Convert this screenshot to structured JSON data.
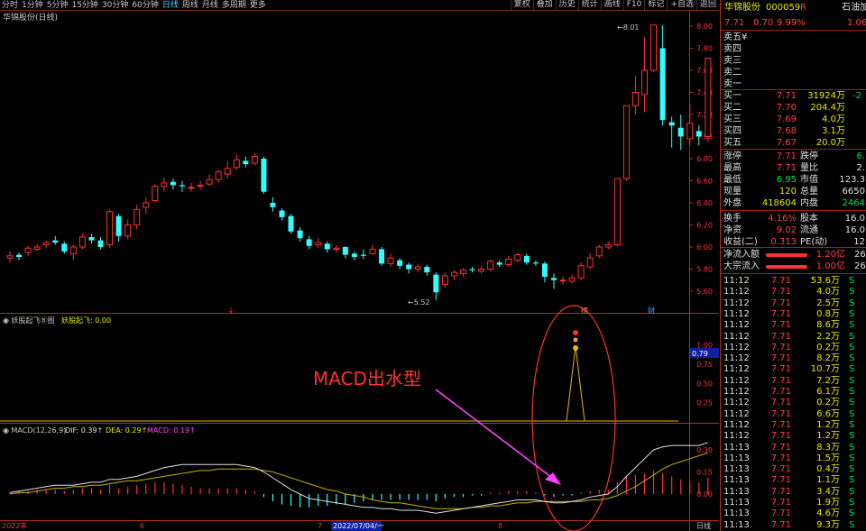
{
  "toolbar": {
    "tabs": [
      "分时",
      "1分钟",
      "5分钟",
      "15分钟",
      "30分钟",
      "60分钟",
      "日线",
      "周线",
      "月线",
      "多周期",
      "更多"
    ],
    "active": "日线",
    "buttons": [
      "复权",
      "叠加",
      "历史",
      "统计",
      "画线",
      "F10",
      "标记",
      "+自选",
      "返回"
    ]
  },
  "main_chart": {
    "title": "华锦股份(日线)",
    "price_axis": [
      "8.00",
      "7.80",
      "7.60",
      "7.40",
      "7.20",
      "7.00",
      "6.80",
      "6.60",
      "6.40",
      "6.20",
      "6.00",
      "5.80",
      "5.60"
    ],
    "high_label": "8.01",
    "low_label": "5.52",
    "marks": {
      "m1": "↓",
      "m2": "榜",
      "m3": "财"
    }
  },
  "indicator1": {
    "title": "妖股起飞Ⓑ图",
    "value_label": "妖股起飞: 0.00",
    "axis": [
      "1.00",
      "0.75",
      "0.50",
      "0.25"
    ],
    "current": "0.79"
  },
  "annotation": "MACD出水型",
  "macd": {
    "title": "MACD(12,26,9)",
    "dif": "DIF: 0.39↑",
    "dea": "DEA: 0.29↑",
    "macd": "MACD: 0.19↑",
    "axis": [
      "0.30",
      "0.15",
      "0.00"
    ]
  },
  "date_axis": {
    "labels": [
      "2022年",
      "6",
      "7",
      "2022/07/04/一",
      "8"
    ],
    "period": "日线"
  },
  "quote": {
    "name": "华锦股份",
    "code": "000059",
    "flag": "R",
    "tab": "石油加工",
    "price": "7.71",
    "change": "0.70",
    "pct": "9.99%",
    "side_val": "1.06",
    "asks": [
      {
        "label": "卖五",
        "price": "",
        "vol": ""
      },
      {
        "label": "卖四",
        "price": "",
        "vol": ""
      },
      {
        "label": "卖三",
        "price": "",
        "vol": ""
      },
      {
        "label": "卖二",
        "price": "",
        "vol": ""
      },
      {
        "label": "卖一",
        "price": "",
        "vol": ""
      }
    ],
    "ask_sign": "¥",
    "bids": [
      {
        "label": "买一",
        "price": "7.71",
        "vol": "31924万",
        "extra": "-2"
      },
      {
        "label": "买二",
        "price": "7.70",
        "vol": "204.4万",
        "extra": ""
      },
      {
        "label": "买三",
        "price": "7.69",
        "vol": "4.0万",
        "extra": ""
      },
      {
        "label": "买四",
        "price": "7.68",
        "vol": "3.1万",
        "extra": ""
      },
      {
        "label": "买五",
        "price": "7.67",
        "vol": "20.0万",
        "extra": ""
      }
    ],
    "stats": [
      {
        "l1": "涨停",
        "v1": "7.71",
        "l2": "跌停",
        "v2": "6."
      },
      {
        "l1": "最高",
        "v1": "7.71",
        "l2": "量比",
        "v2": "2."
      },
      {
        "l1": "最低",
        "v1": "6.95",
        "l2": "市值",
        "v2": "123.3"
      },
      {
        "l1": "现量",
        "v1": "120",
        "l2": "总量",
        "v2": "6650"
      },
      {
        "l1": "外盘",
        "v1": "418604",
        "l2": "内盘",
        "v2": "2464"
      },
      {
        "l1": "换手",
        "v1": "4.16%",
        "l2": "股本",
        "v2": "16.0"
      },
      {
        "l1": "净资",
        "v1": "9.02",
        "l2": "流通",
        "v2": "16.0"
      },
      {
        "l1": "收益(二)",
        "v1": "0.313",
        "l2": "PE(动)",
        "v2": "12"
      }
    ],
    "flows": [
      {
        "label": "净流入额",
        "value": "1.20亿",
        "extra": "26"
      },
      {
        "label": "大宗流入",
        "value": "1.00亿",
        "extra": "26"
      }
    ],
    "ticks": [
      {
        "t": "11:12",
        "p": "7.71",
        "v": "53.6万",
        "s": "S"
      },
      {
        "t": "11:12",
        "p": "7.71",
        "v": "4.0万",
        "s": "S"
      },
      {
        "t": "11:12",
        "p": "7.71",
        "v": "2.5万",
        "s": "S"
      },
      {
        "t": "11:12",
        "p": "7.71",
        "v": "0.8万",
        "s": "S"
      },
      {
        "t": "11:12",
        "p": "7.71",
        "v": "8.6万",
        "s": "S"
      },
      {
        "t": "11:12",
        "p": "7.71",
        "v": "2.2万",
        "s": "S"
      },
      {
        "t": "11:12",
        "p": "7.71",
        "v": "0.2万",
        "s": "S"
      },
      {
        "t": "11:12",
        "p": "7.71",
        "v": "8.2万",
        "s": "S"
      },
      {
        "t": "11:12",
        "p": "7.71",
        "v": "10.7万",
        "s": "S"
      },
      {
        "t": "11:12",
        "p": "7.71",
        "v": "7.2万",
        "s": "S"
      },
      {
        "t": "11:12",
        "p": "7.71",
        "v": "6.1万",
        "s": "S"
      },
      {
        "t": "11:12",
        "p": "7.71",
        "v": "0.2万",
        "s": "S"
      },
      {
        "t": "11:12",
        "p": "7.71",
        "v": "6.6万",
        "s": "S"
      },
      {
        "t": "11:12",
        "p": "7.71",
        "v": "1.2万",
        "s": "S"
      },
      {
        "t": "11:12",
        "p": "7.71",
        "v": "1.2万",
        "s": "S"
      },
      {
        "t": "11:13",
        "p": "7.71",
        "v": "8.3万",
        "s": "S"
      },
      {
        "t": "11:13",
        "p": "7.71",
        "v": "1.5万",
        "s": "S"
      },
      {
        "t": "11:13",
        "p": "7.71",
        "v": "0.4万",
        "s": "S"
      },
      {
        "t": "11:13",
        "p": "7.71",
        "v": "1.1万",
        "s": "S"
      },
      {
        "t": "11:13",
        "p": "7.71",
        "v": "3.4万",
        "s": "S"
      },
      {
        "t": "11:13",
        "p": "7.71",
        "v": "1.9万",
        "s": "S"
      },
      {
        "t": "11:13",
        "p": "7.71",
        "v": "4.6万",
        "s": "S"
      },
      {
        "t": "11:13",
        "p": "7.71",
        "v": "9.3万",
        "s": "S"
      }
    ]
  },
  "colors": {
    "up": "#ff3030",
    "down": "#30ffff",
    "border": "#b0301e",
    "annot": "#ff3030",
    "arrow": "#ff40ff"
  }
}
